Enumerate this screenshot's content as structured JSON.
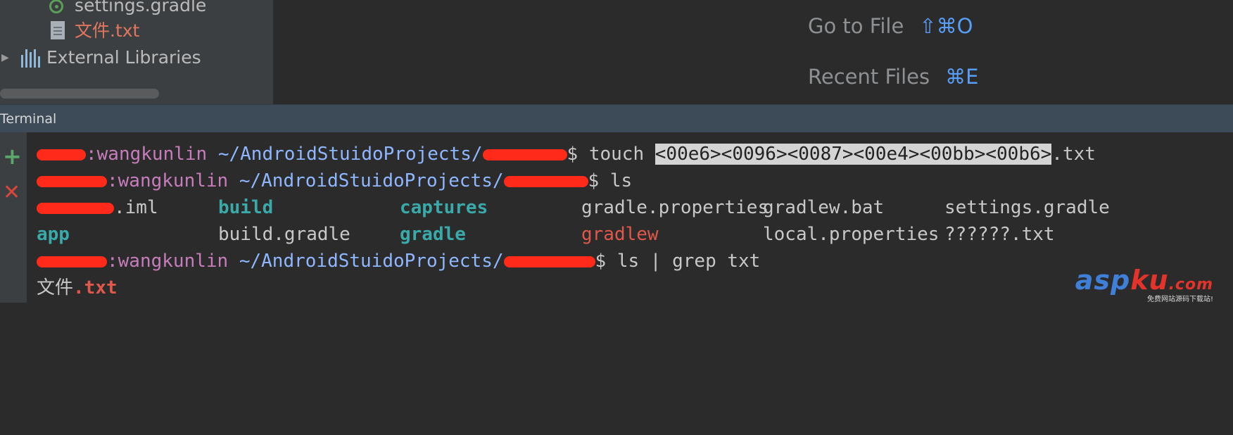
{
  "project_tree": {
    "items": [
      {
        "label": "settings.gradle",
        "icon": "gradle-circle-icon"
      },
      {
        "label": "文件.txt",
        "icon": "text-file-icon"
      },
      {
        "label": "External Libraries",
        "icon": "library-bars-icon"
      }
    ]
  },
  "editor_hints": [
    {
      "label": "Go to File",
      "shortcut": "⇧⌘O"
    },
    {
      "label": "Recent Files",
      "shortcut": "⌘E"
    }
  ],
  "terminal": {
    "title": "Terminal",
    "lines": {
      "l1": {
        "user": ":wangkunlin",
        "path": " ~/AndroidStuidoProjects/",
        "cmd": "$ touch ",
        "selected": "<00e6><0096><0087><00e4><00bb><00b6>",
        "ext": ".txt"
      },
      "l2": {
        "user": ":wangkunlin",
        "path": " ~/AndroidStuidoProjects/",
        "cmd": "$ ls"
      },
      "l3": [
        ".iml",
        "build",
        "captures",
        "gradle.properties",
        "gradlew.bat",
        "settings.gradle"
      ],
      "l4": [
        "app",
        "build.gradle",
        "gradle",
        "gradlew",
        "local.properties",
        "??????.txt"
      ],
      "l5": {
        "user": ":wangkunlin",
        "path": " ~/AndroidStuidoProjects/",
        "cmd": "$ ls | grep txt"
      },
      "l6": {
        "name": "文件",
        "ext": ".txt"
      }
    }
  },
  "watermark": {
    "brand": "asp",
    "brand_ku": "ku",
    "suffix": ".com",
    "tagline": "免费网站源码下载站!"
  },
  "colors": {
    "accent": "#589df6",
    "error": "#d9463a",
    "add": "#59a869"
  }
}
